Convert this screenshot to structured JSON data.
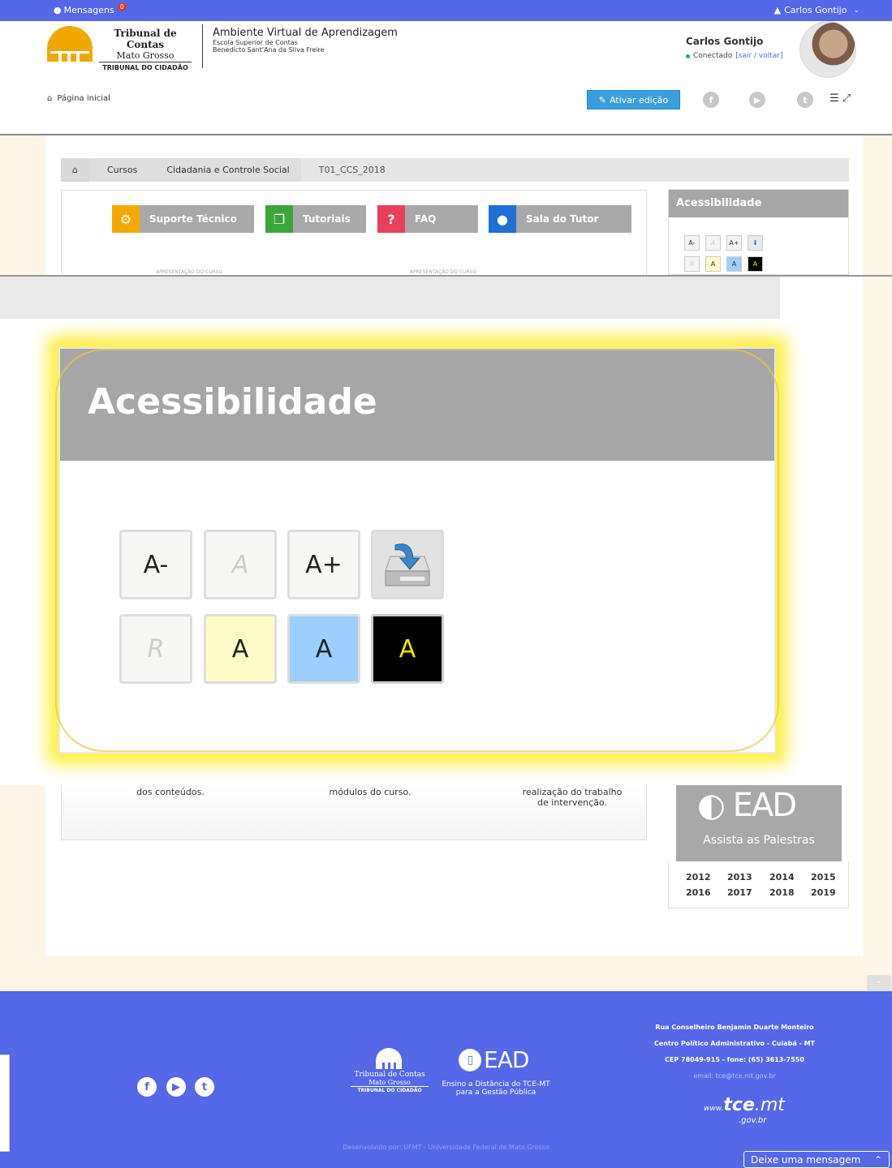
{
  "topbar": {
    "messages_label": "Mensagens",
    "messages_count": "0",
    "user_label": "Carlos Gontijo"
  },
  "header": {
    "logo_line1": "Tribunal de Contas",
    "logo_line2": "Mato Grosso",
    "logo_line3": "TRIBUNAL DO CIDADÃO",
    "ava_title": "Ambiente  Virtual de Aprendizagem",
    "ava_sub1": "Escola Superior de Contas",
    "ava_sub2": "Benedicto Sant'Ana da Silva Freire",
    "profile_name": "Carlos Gontijo",
    "status_text": "Conectado",
    "status_link": "[sair / voltar]",
    "home_link": "Página inicial",
    "edit_button": "Ativar edição"
  },
  "breadcrumb": [
    "Cursos",
    "Cidadania e Controle Social",
    "T01_CCS_2018"
  ],
  "course_tiles": [
    {
      "label": "Suporte Técnico",
      "icon": "gear-icon",
      "color": "#f5a800"
    },
    {
      "label": "Tutoriais",
      "icon": "documents-icon",
      "color": "#3aa63a"
    },
    {
      "label": "FAQ",
      "icon": "question-icon",
      "color": "#e8405a"
    },
    {
      "label": "Sala do Tutor",
      "icon": "user-icon",
      "color": "#1f6fd6"
    }
  ],
  "apresentacao": "APRESENTAÇÃO DO CURSO",
  "accessibility": {
    "title": "Acessibilidade",
    "buttons_row1": [
      "A-",
      "A",
      "A+"
    ],
    "buttons_row2": [
      "R",
      "A",
      "A",
      "A"
    ]
  },
  "below_texts": [
    "dos conteúdos.",
    "módulos do curso.",
    "realização do trabalho de intervenção."
  ],
  "ead": {
    "brand": "EAD",
    "caption": "Assista as Palestras"
  },
  "years": [
    "2012",
    "2013",
    "2014",
    "2015",
    "2016",
    "2017",
    "2018",
    "2019"
  ],
  "footer": {
    "tce_line1": "Tribunal de Contas",
    "tce_line2": "Mato Grosso",
    "tce_line3": "TRIBUNAL DO CIDADÃO",
    "ead_brand": "EAD",
    "ead_line1": "Ensino a Distância do TCE-MT",
    "ead_line2": "para a Gestão Pública",
    "addr1": "Rua Conselheiro Benjamin Duarte Monteiro",
    "addr2": "Centro Político Administrativo - Cuiabá - MT",
    "addr3": "CEP 78049-915 - fone: (65) 3613-7550",
    "addr4": "email: tce@tce.mt.gov.br",
    "site_www": "www.",
    "site_tce": "tce",
    "site_mt": ".mt",
    "site_gov": ".gov.br",
    "developer": "Desenvolvido por: UFMT - Universidade Federal de Mato Grosso",
    "message_button": "Deixe uma mensagem"
  }
}
